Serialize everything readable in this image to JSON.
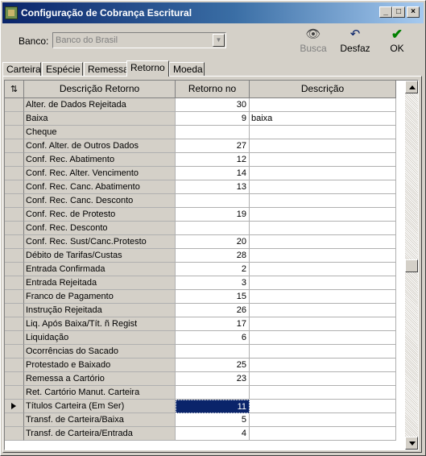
{
  "window": {
    "title": "Configuração de Cobrança Escritural"
  },
  "toolbar": {
    "banco_label": "Banco:",
    "banco_value": "Banco do Brasil",
    "busca_label": "Busca",
    "desfaz_label": "Desfaz",
    "ok_label": "OK"
  },
  "tabs": [
    {
      "label": "Carteira"
    },
    {
      "label": "Espécie"
    },
    {
      "label": "Remessa"
    },
    {
      "label": "Retorno"
    },
    {
      "label": "Moeda"
    }
  ],
  "active_tab": "Retorno",
  "grid": {
    "headers": [
      "Descrição Retorno",
      "Retorno no Banco",
      "Descrição"
    ],
    "current_row_index": 22,
    "rows": [
      {
        "descricao_retorno": "Alter. de Dados Rejeitada",
        "retorno_banco": "30",
        "descricao": ""
      },
      {
        "descricao_retorno": "Baixa",
        "retorno_banco": "9",
        "descricao": "baixa"
      },
      {
        "descricao_retorno": "Cheque",
        "retorno_banco": "",
        "descricao": ""
      },
      {
        "descricao_retorno": "Conf. Alter. de Outros Dados",
        "retorno_banco": "27",
        "descricao": ""
      },
      {
        "descricao_retorno": "Conf. Rec. Abatimento",
        "retorno_banco": "12",
        "descricao": ""
      },
      {
        "descricao_retorno": "Conf. Rec. Alter. Vencimento",
        "retorno_banco": "14",
        "descricao": ""
      },
      {
        "descricao_retorno": "Conf. Rec. Canc. Abatimento",
        "retorno_banco": "13",
        "descricao": ""
      },
      {
        "descricao_retorno": "Conf. Rec. Canc. Desconto",
        "retorno_banco": "",
        "descricao": ""
      },
      {
        "descricao_retorno": "Conf. Rec. de Protesto",
        "retorno_banco": "19",
        "descricao": ""
      },
      {
        "descricao_retorno": "Conf. Rec. Desconto",
        "retorno_banco": "",
        "descricao": ""
      },
      {
        "descricao_retorno": "Conf. Rec. Sust/Canc.Protesto",
        "retorno_banco": "20",
        "descricao": ""
      },
      {
        "descricao_retorno": "Débito de Tarifas/Custas",
        "retorno_banco": "28",
        "descricao": ""
      },
      {
        "descricao_retorno": "Entrada Confirmada",
        "retorno_banco": "2",
        "descricao": ""
      },
      {
        "descricao_retorno": "Entrada Rejeitada",
        "retorno_banco": "3",
        "descricao": ""
      },
      {
        "descricao_retorno": "Franco de Pagamento",
        "retorno_banco": "15",
        "descricao": ""
      },
      {
        "descricao_retorno": "Instrução Rejeitada",
        "retorno_banco": "26",
        "descricao": ""
      },
      {
        "descricao_retorno": "Liq. Após Baixa/Tít. ñ Regist",
        "retorno_banco": "17",
        "descricao": ""
      },
      {
        "descricao_retorno": "Liquidação",
        "retorno_banco": "6",
        "descricao": ""
      },
      {
        "descricao_retorno": "Ocorrências do Sacado",
        "retorno_banco": "",
        "descricao": ""
      },
      {
        "descricao_retorno": "Protestado e Baixado",
        "retorno_banco": "25",
        "descricao": ""
      },
      {
        "descricao_retorno": "Remessa a Cartório",
        "retorno_banco": "23",
        "descricao": ""
      },
      {
        "descricao_retorno": "Ret. Cartório Manut. Carteira",
        "retorno_banco": "",
        "descricao": ""
      },
      {
        "descricao_retorno": "Títulos Carteira (Em Ser)",
        "retorno_banco": "11",
        "descricao": ""
      },
      {
        "descricao_retorno": "Transf. de Carteira/Baixa",
        "retorno_banco": "5",
        "descricao": ""
      },
      {
        "descricao_retorno": "Transf. de Carteira/Entrada",
        "retorno_banco": "4",
        "descricao": ""
      }
    ]
  },
  "icons": {
    "app": "app-icon",
    "busca": "binoculars-icon",
    "desfaz": "undo-icon",
    "ok": "checkmark-icon"
  },
  "colors": {
    "title_start": "#0a246a",
    "title_end": "#a6caf0",
    "selection": "#0a246a",
    "ok_check": "#008000"
  }
}
